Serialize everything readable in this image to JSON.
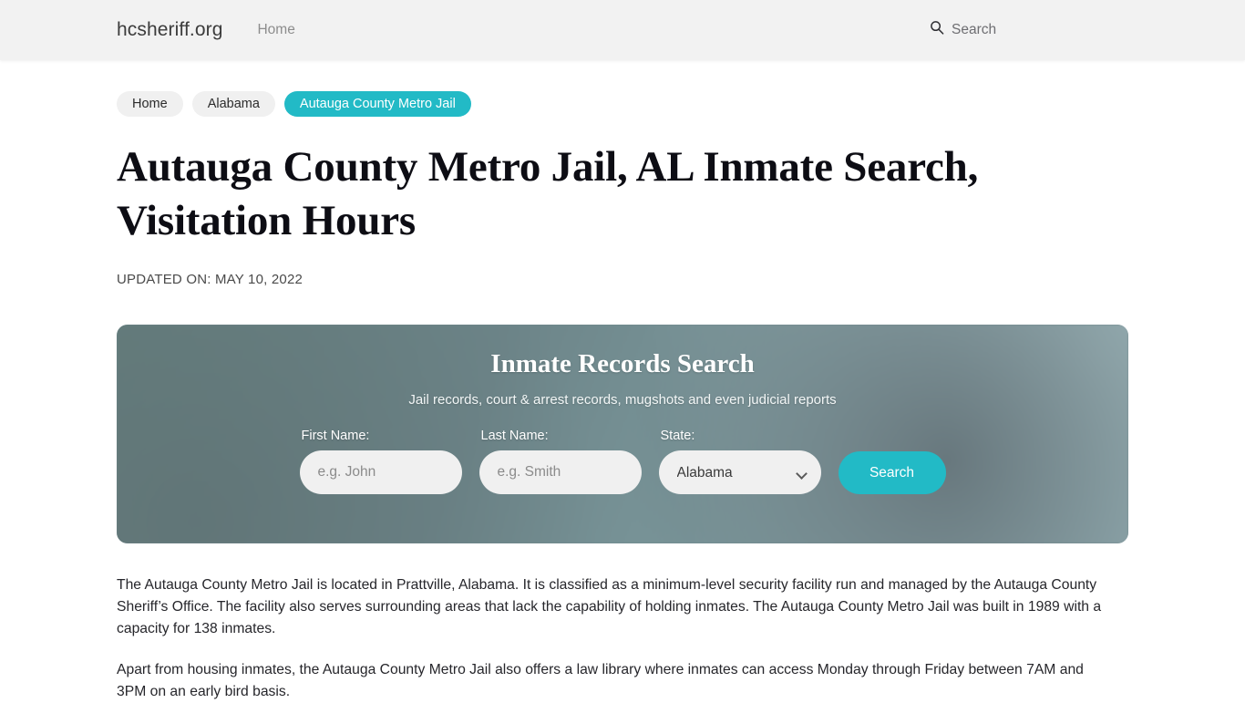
{
  "header": {
    "brand": "hcsheriff.org",
    "nav_home": "Home",
    "search_label": "Search",
    "search_icon": "magnifier-icon"
  },
  "breadcrumb": {
    "items": [
      {
        "label": "Home",
        "active": false
      },
      {
        "label": "Alabama",
        "active": false
      },
      {
        "label": "Autauga County Metro Jail",
        "active": true
      }
    ]
  },
  "article": {
    "title": "Autauga County Metro Jail, AL Inmate Search, Visitation Hours",
    "updated": "UPDATED ON: MAY 10, 2022",
    "paragraphs": [
      "The Autauga County Metro Jail is located in Prattville, Alabama. It is classified as a minimum-level security facility run and managed by the Autauga County Sheriff’s Office. The facility also serves surrounding areas that lack the capability of holding inmates. The Autauga County Metro Jail was built in 1989 with a capacity for 138 inmates.",
      "Apart from housing inmates, the Autauga County Metro Jail also offers a law library where inmates can access Monday through Friday between 7AM and 3PM on an early bird basis."
    ]
  },
  "search_card": {
    "title": "Inmate Records Search",
    "subtitle": "Jail records, court & arrest records, mugshots and even judicial reports",
    "first_name": {
      "label": "First Name:",
      "placeholder": "e.g. John",
      "value": ""
    },
    "last_name": {
      "label": "Last Name:",
      "placeholder": "e.g. Smith",
      "value": ""
    },
    "state": {
      "label": "State:",
      "selected": "Alabama",
      "chevron_icon": "chevron-down-icon"
    },
    "submit_label": "Search"
  },
  "colors": {
    "accent_teal": "#22bac6",
    "card_base": "#6f878b",
    "topbar": "#f2f2f2",
    "pill_inactive": "#f0f0f0",
    "title_text": "#0d0d14"
  }
}
